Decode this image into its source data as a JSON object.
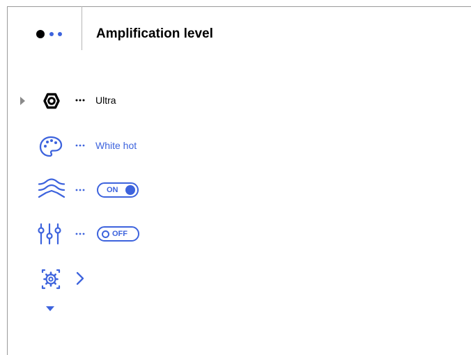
{
  "header": {
    "title": "Amplification level",
    "pager": {
      "pages": 3,
      "current": 1
    }
  },
  "menu": {
    "items": [
      {
        "id": "amplification",
        "icon": "hexagon-nut-icon",
        "value": "Ultra",
        "selected": true
      },
      {
        "id": "palette",
        "icon": "palette-icon",
        "value": "White hot",
        "selected": false
      },
      {
        "id": "smoothing",
        "icon": "waves-icon",
        "toggle": "ON",
        "selected": false
      },
      {
        "id": "equalizer",
        "icon": "sliders-icon",
        "toggle": "OFF",
        "selected": false
      },
      {
        "id": "settings",
        "icon": "gear-frame-icon",
        "selected": false
      }
    ]
  },
  "colors": {
    "accent": "#3d63dd",
    "text": "#000000",
    "divider": "#b5b5b5"
  }
}
